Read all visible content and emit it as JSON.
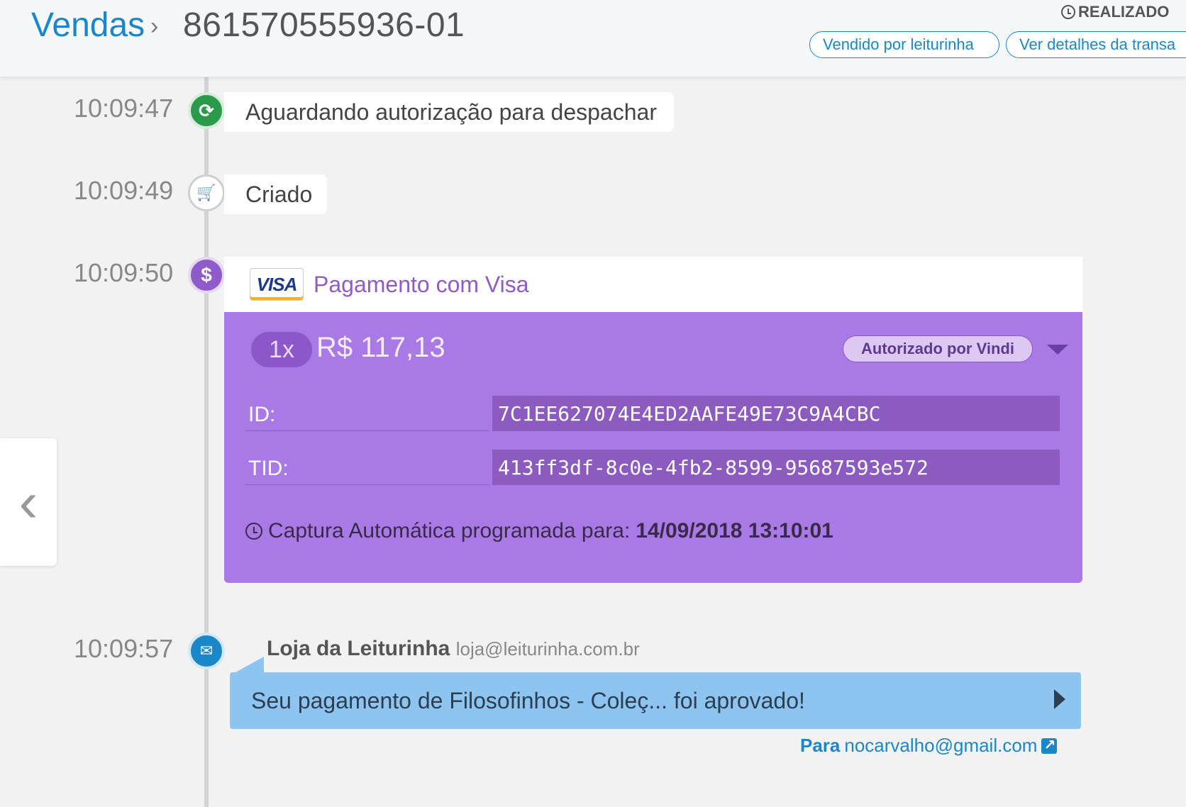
{
  "header": {
    "breadcrumb_root": "Vendas",
    "breadcrumb_separator": "›",
    "order_id": "861570555936-01",
    "status": "REALIZADO",
    "buttons": {
      "sold_by": "Vendido por leiturinha",
      "transaction_details": "Ver detalhes da transa"
    }
  },
  "timeline": {
    "events": [
      {
        "time": "10:09:47",
        "icon": "refresh-icon",
        "glyph": "⟳",
        "text": "Aguardando autorização para despachar"
      },
      {
        "time": "10:09:49",
        "icon": "cart-icon",
        "glyph": "🛒",
        "text": "Criado"
      },
      {
        "time": "10:09:50",
        "icon": "dollar-icon",
        "glyph": "$"
      },
      {
        "time": "10:09:57",
        "icon": "envelope-icon",
        "glyph": "✉"
      }
    ]
  },
  "payment": {
    "card_brand": "VISA",
    "title": "Pagamento com Visa",
    "installments": "1x",
    "amount": "R$ 117,13",
    "authorization": "Autorizado por Vindi",
    "fields": [
      {
        "label": "ID:",
        "value": "7C1EE627074E4ED2AAFE49E73C9A4CBC"
      },
      {
        "label": "TID:",
        "value": "413ff3df-8c0e-4fb2-8599-95687593e572"
      }
    ],
    "capture_label": "Captura Automática programada para:",
    "capture_datetime": "14/09/2018 13:10:01",
    "colors": {
      "card_bg": "#a97ae5",
      "accent": "#8e5bc9"
    }
  },
  "email": {
    "from_name": "Loja da Leiturinha",
    "from_email": "loja@leiturinha.com.br",
    "subject": "Seu pagamento de Filosofinhos - Coleç... foi aprovado!",
    "to_label": "Para",
    "to_email": "nocarvalho@gmail.com"
  },
  "side_nav": {
    "icon": "chevron-left-icon",
    "glyph": "‹"
  }
}
